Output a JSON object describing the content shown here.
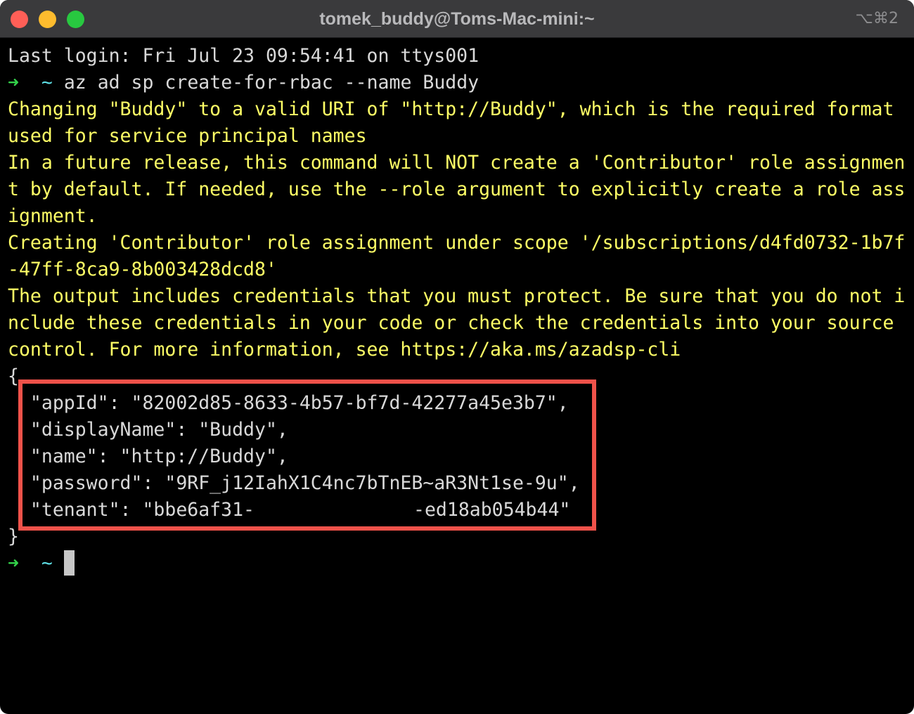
{
  "window": {
    "title": "tomek_buddy@Toms-Mac-mini:~",
    "shortcut": "⌥⌘2"
  },
  "colors": {
    "background": "#000000",
    "default_text": "#d9d9d9",
    "warning_text": "#ffff66",
    "prompt_arrow": "#33d24a",
    "prompt_tilde": "#5ee0e6",
    "highlight_box": "#f0524a"
  },
  "terminal": {
    "last_login": "Last login: Fri Jul 23 09:54:41 on ttys001",
    "prompt_arrow": "➜",
    "prompt_dir": "~",
    "command": "az ad sp create-for-rbac --name Buddy",
    "warning_lines": [
      "Changing \"Buddy\" to a valid URI of \"http://Buddy\", which is the required format",
      "used for service principal names",
      "In a future release, this command will NOT create a 'Contributor' role assignmen",
      "t by default. If needed, use the --role argument to explicitly create a role ass",
      "ignment.",
      "Creating 'Contributor' role assignment under scope '/subscriptions/d4fd0732-1b7f",
      "-47ff-8ca9-8b003428dcd8'",
      "The output includes credentials that you must protect. Be sure that you do not i",
      "nclude these credentials in your code or check the credentials into your source",
      "control. For more information, see https://aka.ms/azadsp-cli"
    ],
    "json_open": "{",
    "json_lines": [
      "  \"appId\": \"82002d85-8633-4b57-bf7d-42277a45e3b7\",",
      "  \"displayName\": \"Buddy\",",
      "  \"name\": \"http://Buddy\",",
      "  \"password\": \"9RF_j12IahX1C4nc7bTnEB~aR3Nt1se-9u\","
    ],
    "tenant_start": "  \"tenant\": \"bbe6af31-",
    "tenant_end": "-ed18ab054b44\"",
    "json_close": "}"
  }
}
